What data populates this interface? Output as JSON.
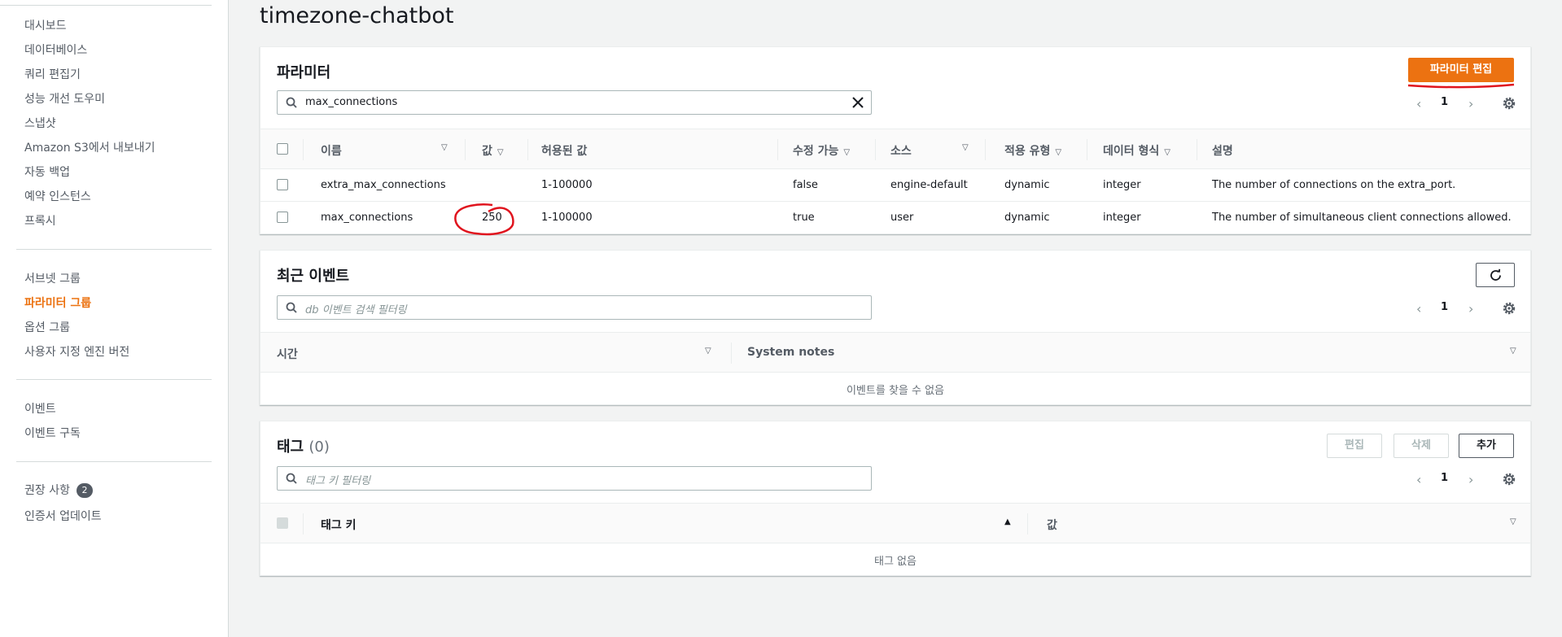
{
  "sidebar": {
    "items": [
      {
        "label": "대시보드"
      },
      {
        "label": "데이터베이스"
      },
      {
        "label": "쿼리 편집기"
      },
      {
        "label": "성능 개선 도우미"
      },
      {
        "label": "스냅샷"
      },
      {
        "label": "Amazon S3에서 내보내기"
      },
      {
        "label": "자동 백업"
      },
      {
        "label": "예약 인스턴스"
      },
      {
        "label": "프록시"
      },
      {
        "label": "서브넷 그룹"
      },
      {
        "label": "파라미터 그룹"
      },
      {
        "label": "옵션 그룹"
      },
      {
        "label": "사용자 지정 엔진 버전"
      },
      {
        "label": "이벤트"
      },
      {
        "label": "이벤트 구독"
      },
      {
        "label": "권장 사항",
        "badge": "2"
      },
      {
        "label": "인증서 업데이트"
      }
    ]
  },
  "page": {
    "title": "timezone-chatbot"
  },
  "parameters": {
    "title": "파라미터",
    "edit_button": "파라미터 편집",
    "search_value": "max_connections",
    "page": "1",
    "columns": [
      "이름",
      "값",
      "허용된 값",
      "수정 가능",
      "소스",
      "적용 유형",
      "데이터 형식",
      "설명"
    ],
    "rows": [
      {
        "name": "extra_max_connections",
        "value": "",
        "allowed": "1-100000",
        "modifiable": "false",
        "source": "engine-default",
        "apply_type": "dynamic",
        "data_type": "integer",
        "description": "The number of connections on the extra_port."
      },
      {
        "name": "max_connections",
        "value": "250",
        "allowed": "1-100000",
        "modifiable": "true",
        "source": "user",
        "apply_type": "dynamic",
        "data_type": "integer",
        "description": "The number of simultaneous client connections allowed."
      }
    ]
  },
  "events": {
    "title": "최근 이벤트",
    "search_placeholder": "db 이벤트 검색 필터링",
    "page": "1",
    "columns": [
      "시간",
      "System notes"
    ],
    "empty": "이벤트를 찾을 수 없음"
  },
  "tags": {
    "title": "태그",
    "count": "(0)",
    "edit_button": "편집",
    "delete_button": "삭제",
    "add_button": "추가",
    "search_placeholder": "태그 키 필터링",
    "page": "1",
    "columns": [
      "태그 키",
      "값"
    ],
    "empty": "태그 없음"
  },
  "colors": {
    "accent": "#ec7211",
    "annotation": "#e0141e"
  }
}
